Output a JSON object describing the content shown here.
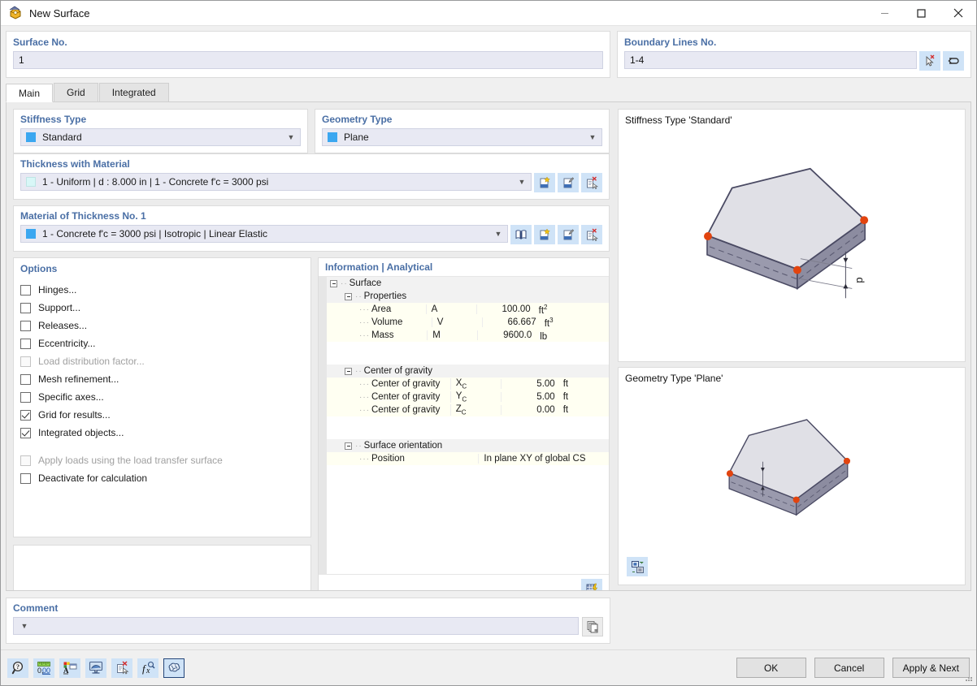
{
  "window": {
    "title": "New Surface",
    "icon": "surface-icon",
    "minimize": "minimize-icon",
    "maximize": "maximize-icon",
    "close": "close-icon"
  },
  "surface_no": {
    "label": "Surface No.",
    "value": "1"
  },
  "boundary_lines": {
    "label": "Boundary Lines No.",
    "value": "1-4",
    "buttons": [
      {
        "name": "pick-lines-button",
        "icon": "cursor-pick-icon"
      },
      {
        "name": "reverse-button",
        "icon": "undo-arrow-icon"
      }
    ]
  },
  "tabs": [
    {
      "label": "Main",
      "active": true
    },
    {
      "label": "Grid",
      "active": false
    },
    {
      "label": "Integrated",
      "active": false
    }
  ],
  "stiffness_type": {
    "label": "Stiffness Type",
    "value": "Standard",
    "swatch": "#3ba7f0"
  },
  "geometry_type": {
    "label": "Geometry Type",
    "value": "Plane",
    "swatch": "#3ba7f0"
  },
  "thickness": {
    "label": "Thickness with Material",
    "value": "1 - Uniform | d : 8.000 in | 1 - Concrete f'c = 3000 psi",
    "swatch": "#d8f7f7",
    "buttons": [
      {
        "name": "new-thickness-button",
        "icon": "new-page-icon"
      },
      {
        "name": "edit-thickness-button",
        "icon": "edit-page-icon"
      },
      {
        "name": "delete-thickness-button",
        "icon": "delete-page-icon"
      }
    ]
  },
  "material": {
    "label": "Material of Thickness No. 1",
    "value": "1 - Concrete f'c = 3000 psi | Isotropic | Linear Elastic",
    "swatch": "#3ba7f0",
    "buttons": [
      {
        "name": "material-library-button",
        "icon": "book-icon"
      },
      {
        "name": "new-material-button",
        "icon": "new-page-icon"
      },
      {
        "name": "edit-material-button",
        "icon": "edit-page-icon"
      },
      {
        "name": "delete-material-button",
        "icon": "delete-page-icon"
      }
    ]
  },
  "options": {
    "label": "Options",
    "items": [
      {
        "label": "Hinges...",
        "checked": false,
        "disabled": false,
        "gap": false,
        "name": "option-hinges"
      },
      {
        "label": "Support...",
        "checked": false,
        "disabled": false,
        "gap": false,
        "name": "option-support"
      },
      {
        "label": "Releases...",
        "checked": false,
        "disabled": false,
        "gap": false,
        "name": "option-releases"
      },
      {
        "label": "Eccentricity...",
        "checked": false,
        "disabled": false,
        "gap": false,
        "name": "option-eccentricity"
      },
      {
        "label": "Load distribution factor...",
        "checked": false,
        "disabled": true,
        "gap": false,
        "name": "option-load-distribution-factor"
      },
      {
        "label": "Mesh refinement...",
        "checked": false,
        "disabled": false,
        "gap": false,
        "name": "option-mesh-refinement"
      },
      {
        "label": "Specific axes...",
        "checked": false,
        "disabled": false,
        "gap": false,
        "name": "option-specific-axes"
      },
      {
        "label": "Grid for results...",
        "checked": true,
        "disabled": false,
        "gap": false,
        "name": "option-grid-for-results"
      },
      {
        "label": "Integrated objects...",
        "checked": true,
        "disabled": false,
        "gap": false,
        "name": "option-integrated-objects"
      },
      {
        "label": "Apply loads using the load transfer surface",
        "checked": false,
        "disabled": true,
        "gap": true,
        "name": "option-apply-loads-load-transfer-surface"
      },
      {
        "label": "Deactivate for calculation",
        "checked": false,
        "disabled": false,
        "gap": false,
        "name": "option-deactivate-for-calculation"
      }
    ]
  },
  "information": {
    "header": "Information | Analytical",
    "root": "Surface",
    "groups": [
      {
        "name": "Properties",
        "rows": [
          {
            "label": "Area",
            "symbol": "A",
            "value": "100.00",
            "unit": "ft",
            "unit_sup": "2"
          },
          {
            "label": "Volume",
            "symbol": "V",
            "value": "66.667",
            "unit": "ft",
            "unit_sup": "3"
          },
          {
            "label": "Mass",
            "symbol": "M",
            "value": "9600.0",
            "unit": "lb",
            "unit_sup": ""
          }
        ]
      },
      {
        "name": "Center of gravity",
        "rows": [
          {
            "label": "Center of gravity",
            "symbol": "X",
            "symbol_sub": "C",
            "value": "5.00",
            "unit": "ft",
            "unit_sup": ""
          },
          {
            "label": "Center of gravity",
            "symbol": "Y",
            "symbol_sub": "C",
            "value": "5.00",
            "unit": "ft",
            "unit_sup": ""
          },
          {
            "label": "Center of gravity",
            "symbol": "Z",
            "symbol_sub": "C",
            "value": "0.00",
            "unit": "ft",
            "unit_sup": ""
          }
        ]
      }
    ],
    "orientation": {
      "name": "Surface orientation",
      "row_label": "Position",
      "row_value": "In plane XY of global CS"
    },
    "footer_button": {
      "name": "results-table-button",
      "icon": "table-lightning-icon"
    }
  },
  "previews": [
    {
      "label": "Stiffness Type 'Standard'",
      "name": "stiffness-preview",
      "dimension_label": "d",
      "show_dimension_right": true
    },
    {
      "label": "Geometry Type 'Plane'",
      "name": "geometry-preview",
      "show_dimension_right": false,
      "toolbutton": {
        "name": "view-mode-button",
        "icon": "view-switch-icon"
      }
    }
  ],
  "comment": {
    "label": "Comment",
    "value": "",
    "placeholder": "",
    "copy_button": {
      "name": "copy-comment-button",
      "icon": "copy-icon"
    }
  },
  "bottom_toolbar": [
    {
      "name": "info-button",
      "icon": "info-magnifier-icon",
      "selected": false
    },
    {
      "name": "units-button",
      "icon": "units-ruler-icon",
      "selected": false
    },
    {
      "name": "display-properties-button",
      "icon": "display-properties-icon",
      "selected": false
    },
    {
      "name": "view-settings-button",
      "icon": "monitor-icon",
      "selected": false
    },
    {
      "name": "delete-object-button",
      "icon": "delete-object-icon",
      "selected": false
    },
    {
      "name": "formula-button",
      "icon": "formula-fx-icon",
      "selected": false
    },
    {
      "name": "brain-button",
      "icon": "brain-icon",
      "selected": true
    }
  ],
  "actions": [
    {
      "label": "OK",
      "name": "ok-button"
    },
    {
      "label": "Cancel",
      "name": "cancel-button"
    },
    {
      "label": "Apply & Next",
      "name": "apply-next-button"
    }
  ],
  "colors": {
    "accent_label": "#4a6fa5",
    "field_bg": "#e8e9f3",
    "icon_btn_bg": "#cfe3f7",
    "node_red": "#e2440f",
    "slab_top": "#e0e0e6",
    "slab_side": "#9a9aad"
  }
}
